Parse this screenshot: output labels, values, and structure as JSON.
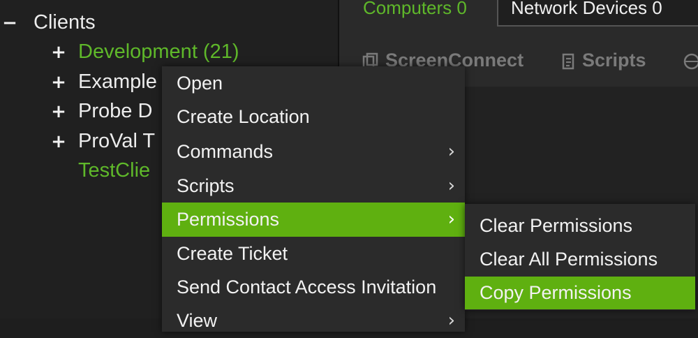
{
  "tree": {
    "root": {
      "toggle": "−",
      "label": "Clients"
    },
    "children": [
      {
        "toggle": "+",
        "label": "Development (21)",
        "color": "#5fb82a"
      },
      {
        "toggle": "+",
        "label": "Example"
      },
      {
        "toggle": "+",
        "label": "Probe D"
      },
      {
        "toggle": "+",
        "label": "ProVal T"
      },
      {
        "toggle": "",
        "label": "TestClie",
        "color": "#5fb82a"
      }
    ]
  },
  "tabs": {
    "computers": "Computers 0",
    "network": "Network Devices 0"
  },
  "toolbar": {
    "screenconnect": "ScreenConnect",
    "scripts": "Scripts"
  },
  "context_menu": {
    "items": [
      {
        "label": "Open",
        "submenu": false
      },
      {
        "label": "Create Location",
        "submenu": false
      },
      {
        "label": "Commands",
        "submenu": true
      },
      {
        "label": "Scripts",
        "submenu": true
      },
      {
        "label": "Permissions",
        "submenu": true,
        "active": true
      },
      {
        "label": "Create Ticket",
        "submenu": false
      },
      {
        "label": "Send Contact Access Invitation",
        "submenu": false
      },
      {
        "label": "View",
        "submenu": true
      }
    ],
    "arrow": "›"
  },
  "submenu": {
    "items": [
      {
        "label": "Clear Permissions"
      },
      {
        "label": "Clear All Permissions"
      },
      {
        "label": "Copy Permissions",
        "active": true
      }
    ]
  },
  "colors": {
    "accent": "#5fb010",
    "tree_green": "#5fb82a",
    "menu_bg": "#2b2b2b"
  }
}
